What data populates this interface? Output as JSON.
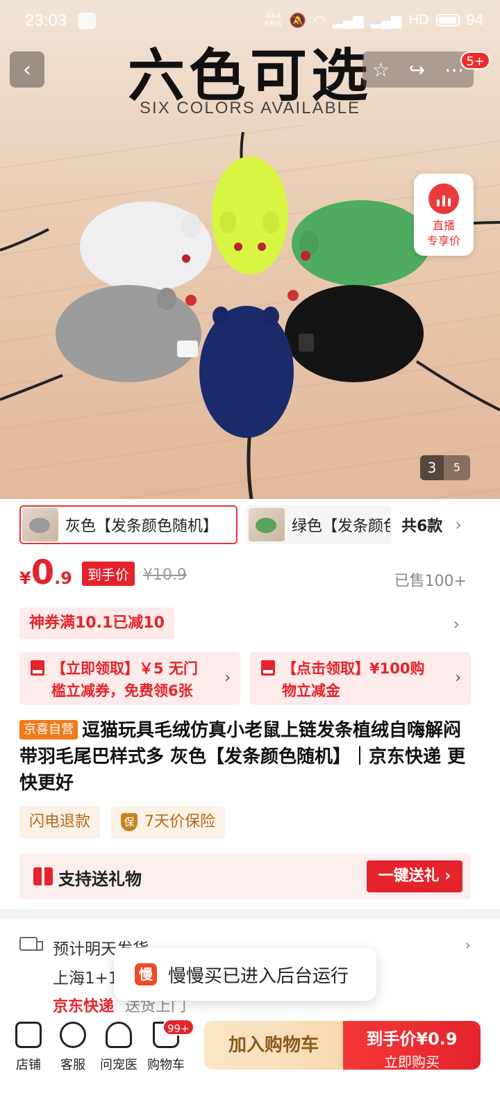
{
  "status_bar": {
    "time": "23:03",
    "net_speed": "43.4\nKB/S",
    "signal_1": "4G",
    "signal_2": "5G",
    "hd": "HD",
    "battery": "94"
  },
  "hero": {
    "title": "六色可选",
    "subtitle": "SIX COLORS AVAILABLE",
    "notif_badge": "5+",
    "live_line1": "直播",
    "live_line2": "专享价",
    "page_current": "3",
    "page_total": "5"
  },
  "variants": {
    "selected_label": "灰色【发条颜色随机】",
    "other_label": "绿色【发条颜色随机】",
    "count_label": "共6款"
  },
  "price": {
    "currency": "¥",
    "integer": "0",
    "decimal": ".9",
    "tag": "到手价",
    "original": "¥10.9",
    "sold": "已售100+"
  },
  "coupon": {
    "chip": "神券满10.1已减10"
  },
  "promos": [
    {
      "line1": "【立即领取】￥5 无门",
      "line2": "槛立减券，免费领6张"
    },
    {
      "line1": "【点击领取】¥100购",
      "line2": "物立减金"
    }
  ],
  "product": {
    "store_tag": "京喜自营",
    "title": "逗猫玩具毛绒仿真小老鼠上链发条植绒自嗨解闷带羽毛尾巴样式多 灰色【发条颜色随机】｜京东快递 更快更好"
  },
  "services": [
    {
      "label": "闪电退款"
    },
    {
      "icon_text": "保",
      "label": "7天价保险"
    }
  ],
  "gift": {
    "label": "支持送礼物",
    "button": "一键送礼 ›"
  },
  "shipping": {
    "line1": "预计明天发货",
    "line2": "上海1+1",
    "express": "京东快递",
    "express_note": "送货上门"
  },
  "toast": {
    "icon_text": "慢",
    "text": "慢慢买已进入后台运行"
  },
  "bottom_bar": {
    "tabs": [
      {
        "label": "店铺"
      },
      {
        "label": "客服"
      },
      {
        "label": "问宠医"
      },
      {
        "label": "购物车"
      }
    ],
    "cart_badge": "99+",
    "add_to_cart": "加入购物车",
    "buy_line1": "到手价¥0.9",
    "buy_line2": "立即购买"
  },
  "colors": {
    "accent": "#e4232b",
    "gold": "#b46a1d"
  }
}
